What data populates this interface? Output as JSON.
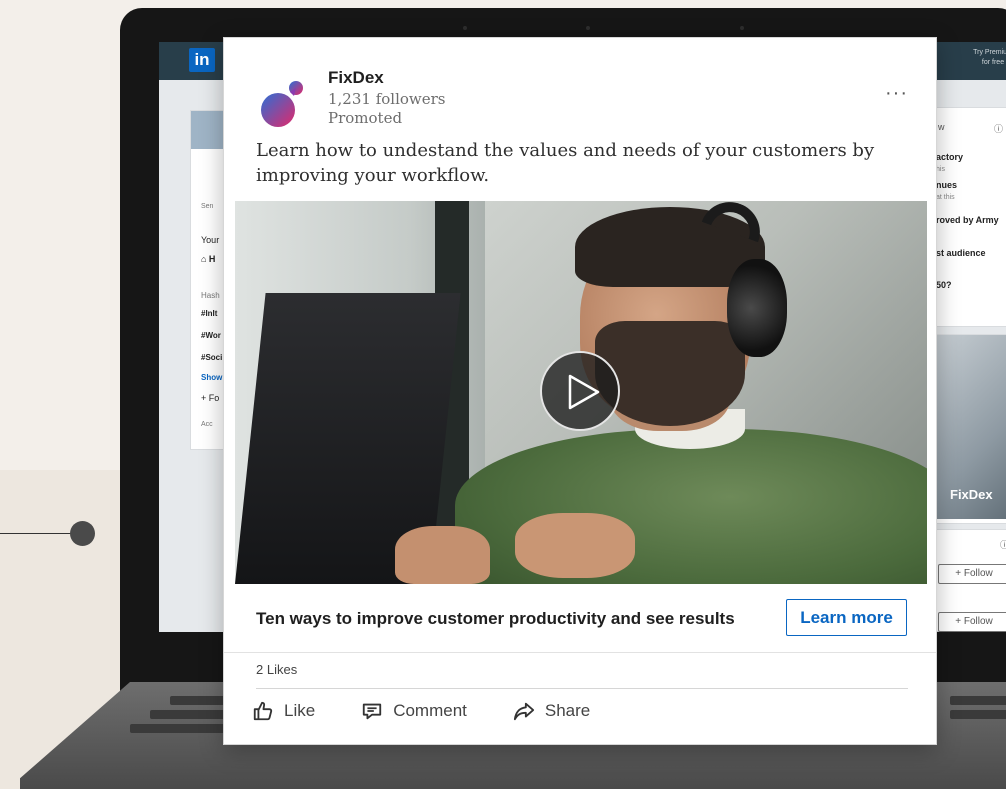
{
  "background_app": {
    "logo_text": "in",
    "premium_line1": "Try Premium",
    "premium_line2": "for free",
    "left_sidebar": {
      "lines": [
        "Sen",
        "Your",
        "⌂ H",
        "Hash",
        "#InIt",
        "#Wor",
        "#Soci",
        "Show",
        "+ Fo",
        "Acc"
      ]
    },
    "right_sidebar": {
      "lines": [
        "w",
        "actory",
        "his",
        "nues",
        "at this",
        "roved by Army",
        "st audience",
        "50?"
      ],
      "ad_brand": "FixDex",
      "follow_buttons": [
        "+ Follow",
        "+ Follow"
      ]
    }
  },
  "post": {
    "company": "FixDex",
    "followers": "1,231 followers",
    "promoted": "Promoted",
    "more_label": "···",
    "text": "Learn how to undestand the values and needs of your customers by improving your workflow.",
    "headline": "Ten ways to improve customer productivity and see results",
    "cta": "Learn more",
    "likes": "2 Likes",
    "actions": [
      {
        "label": "Like",
        "icon": "thumbs-up-icon"
      },
      {
        "label": "Comment",
        "icon": "comment-icon"
      },
      {
        "label": "Share",
        "icon": "share-icon"
      }
    ]
  },
  "colors": {
    "brand_blue": "#0a66c2",
    "logo_gradient_start": "#2b6fd6",
    "logo_gradient_end": "#e2286a"
  }
}
